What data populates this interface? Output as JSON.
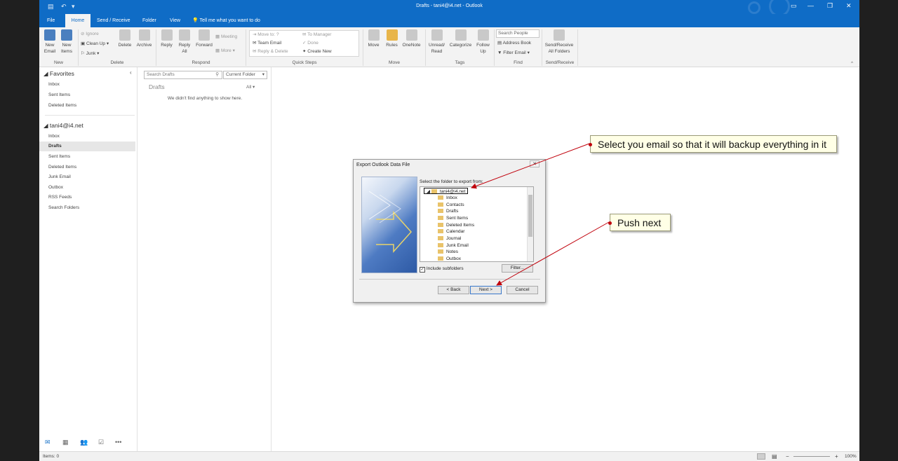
{
  "titlebar": {
    "title": "Drafts - tani4@i4.net - Outlook"
  },
  "tabs": [
    "File",
    "Home",
    "Send / Receive",
    "Folder",
    "View"
  ],
  "tell_me": "Tell me what you want to do",
  "ribbon": {
    "new_email": "New Email",
    "new_items": "New Items",
    "ignore": "Ignore",
    "clean_up": "Clean Up",
    "junk": "Junk",
    "delete": "Delete",
    "archive": "Archive",
    "reply": "Reply",
    "reply_all": "Reply All",
    "forward": "Forward",
    "meeting": "Meeting",
    "more": "More",
    "quick_steps": [
      "Move to: ?",
      "To Manager",
      "Team Email",
      "Done",
      "Reply & Delete",
      "Create New"
    ],
    "move": "Move",
    "rules": "Rules",
    "onenote": "OneNote",
    "unread_read": "Unread/ Read",
    "categorize": "Categorize",
    "follow_up": "Follow Up",
    "search_people": "Search People",
    "address_book": "Address Book",
    "filter_email": "Filter Email",
    "send_receive_all": "Send/Receive All Folders",
    "groups": [
      "New",
      "Delete",
      "Respond",
      "Quick Steps",
      "Move",
      "Tags",
      "Find",
      "Send/Receive"
    ]
  },
  "nav": {
    "favorites_header": "Favorites",
    "favorites": [
      "Inbox",
      "Sent Items",
      "Deleted Items"
    ],
    "account": "tani4@i4.net",
    "folders": [
      "Inbox",
      "Drafts",
      "Sent Items",
      "Deleted Items",
      "Junk Email",
      "Outbox",
      "RSS Feeds",
      "Search Folders"
    ]
  },
  "list": {
    "search_placeholder": "Search Drafts",
    "scope": "Current Folder",
    "folder_title": "Drafts",
    "filter": "All",
    "empty_message": "We didn't find anything to show here."
  },
  "dialog": {
    "title": "Export Outlook Data File",
    "prompt": "Select the folder to export from:",
    "root": "tani4@i4.net",
    "folders": [
      "Inbox",
      "Contacts",
      "Drafts",
      "Sent Items",
      "Deleted Items",
      "Calendar",
      "Journal",
      "Junk Email",
      "Notes",
      "Outbox"
    ],
    "include_subfolders": "Include subfolders",
    "filter_btn": "Filter...",
    "back_btn": "< Back",
    "next_btn": "Next >",
    "cancel_btn": "Cancel"
  },
  "callouts": {
    "select": "Select you email so that it will backup everything in it",
    "next": "Push next"
  },
  "status": {
    "items": "Items: 0",
    "zoom": "100%"
  }
}
